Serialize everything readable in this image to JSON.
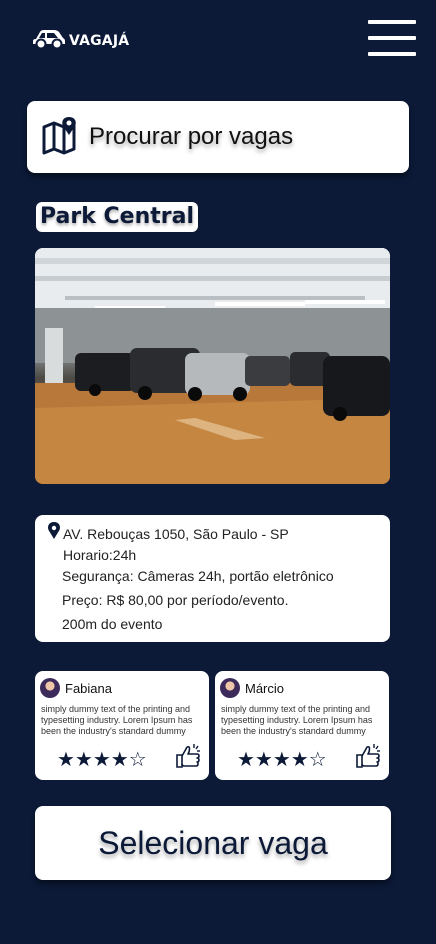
{
  "header": {
    "logo_text": "VAGAJÁ",
    "logo_icon": "car-icon",
    "menu_icon": "hamburger-menu-icon"
  },
  "search": {
    "label": "Procurar por vagas",
    "icon": "map-pin-icon"
  },
  "parking": {
    "name": "Park Central",
    "photo": "parking-garage-photo",
    "address": "AV. Rebouças 1050, São Paulo - SP",
    "hours": "Horario:24h",
    "security": "Segurança: Câmeras 24h, portão eletrônico",
    "price": "Preço: R$ 80,00 por período/evento.",
    "distance": "200m do evento"
  },
  "reviews": [
    {
      "name": "Fabiana",
      "text": "simply dummy text of the printing and typesetting industry. Lorem Ipsum has been the industry's standard dummy",
      "rating": 4,
      "stars": "★★★★☆"
    },
    {
      "name": "Márcio",
      "text": "simply dummy text of the printing and typesetting industry. Lorem Ipsum has been the industry's standard dummy",
      "rating": 4,
      "stars": "★★★★☆"
    }
  ],
  "actions": {
    "select_label": "Selecionar vaga"
  },
  "colors": {
    "background": "#0c1a38",
    "card": "#ffffff",
    "accent": "#0c1a38"
  }
}
